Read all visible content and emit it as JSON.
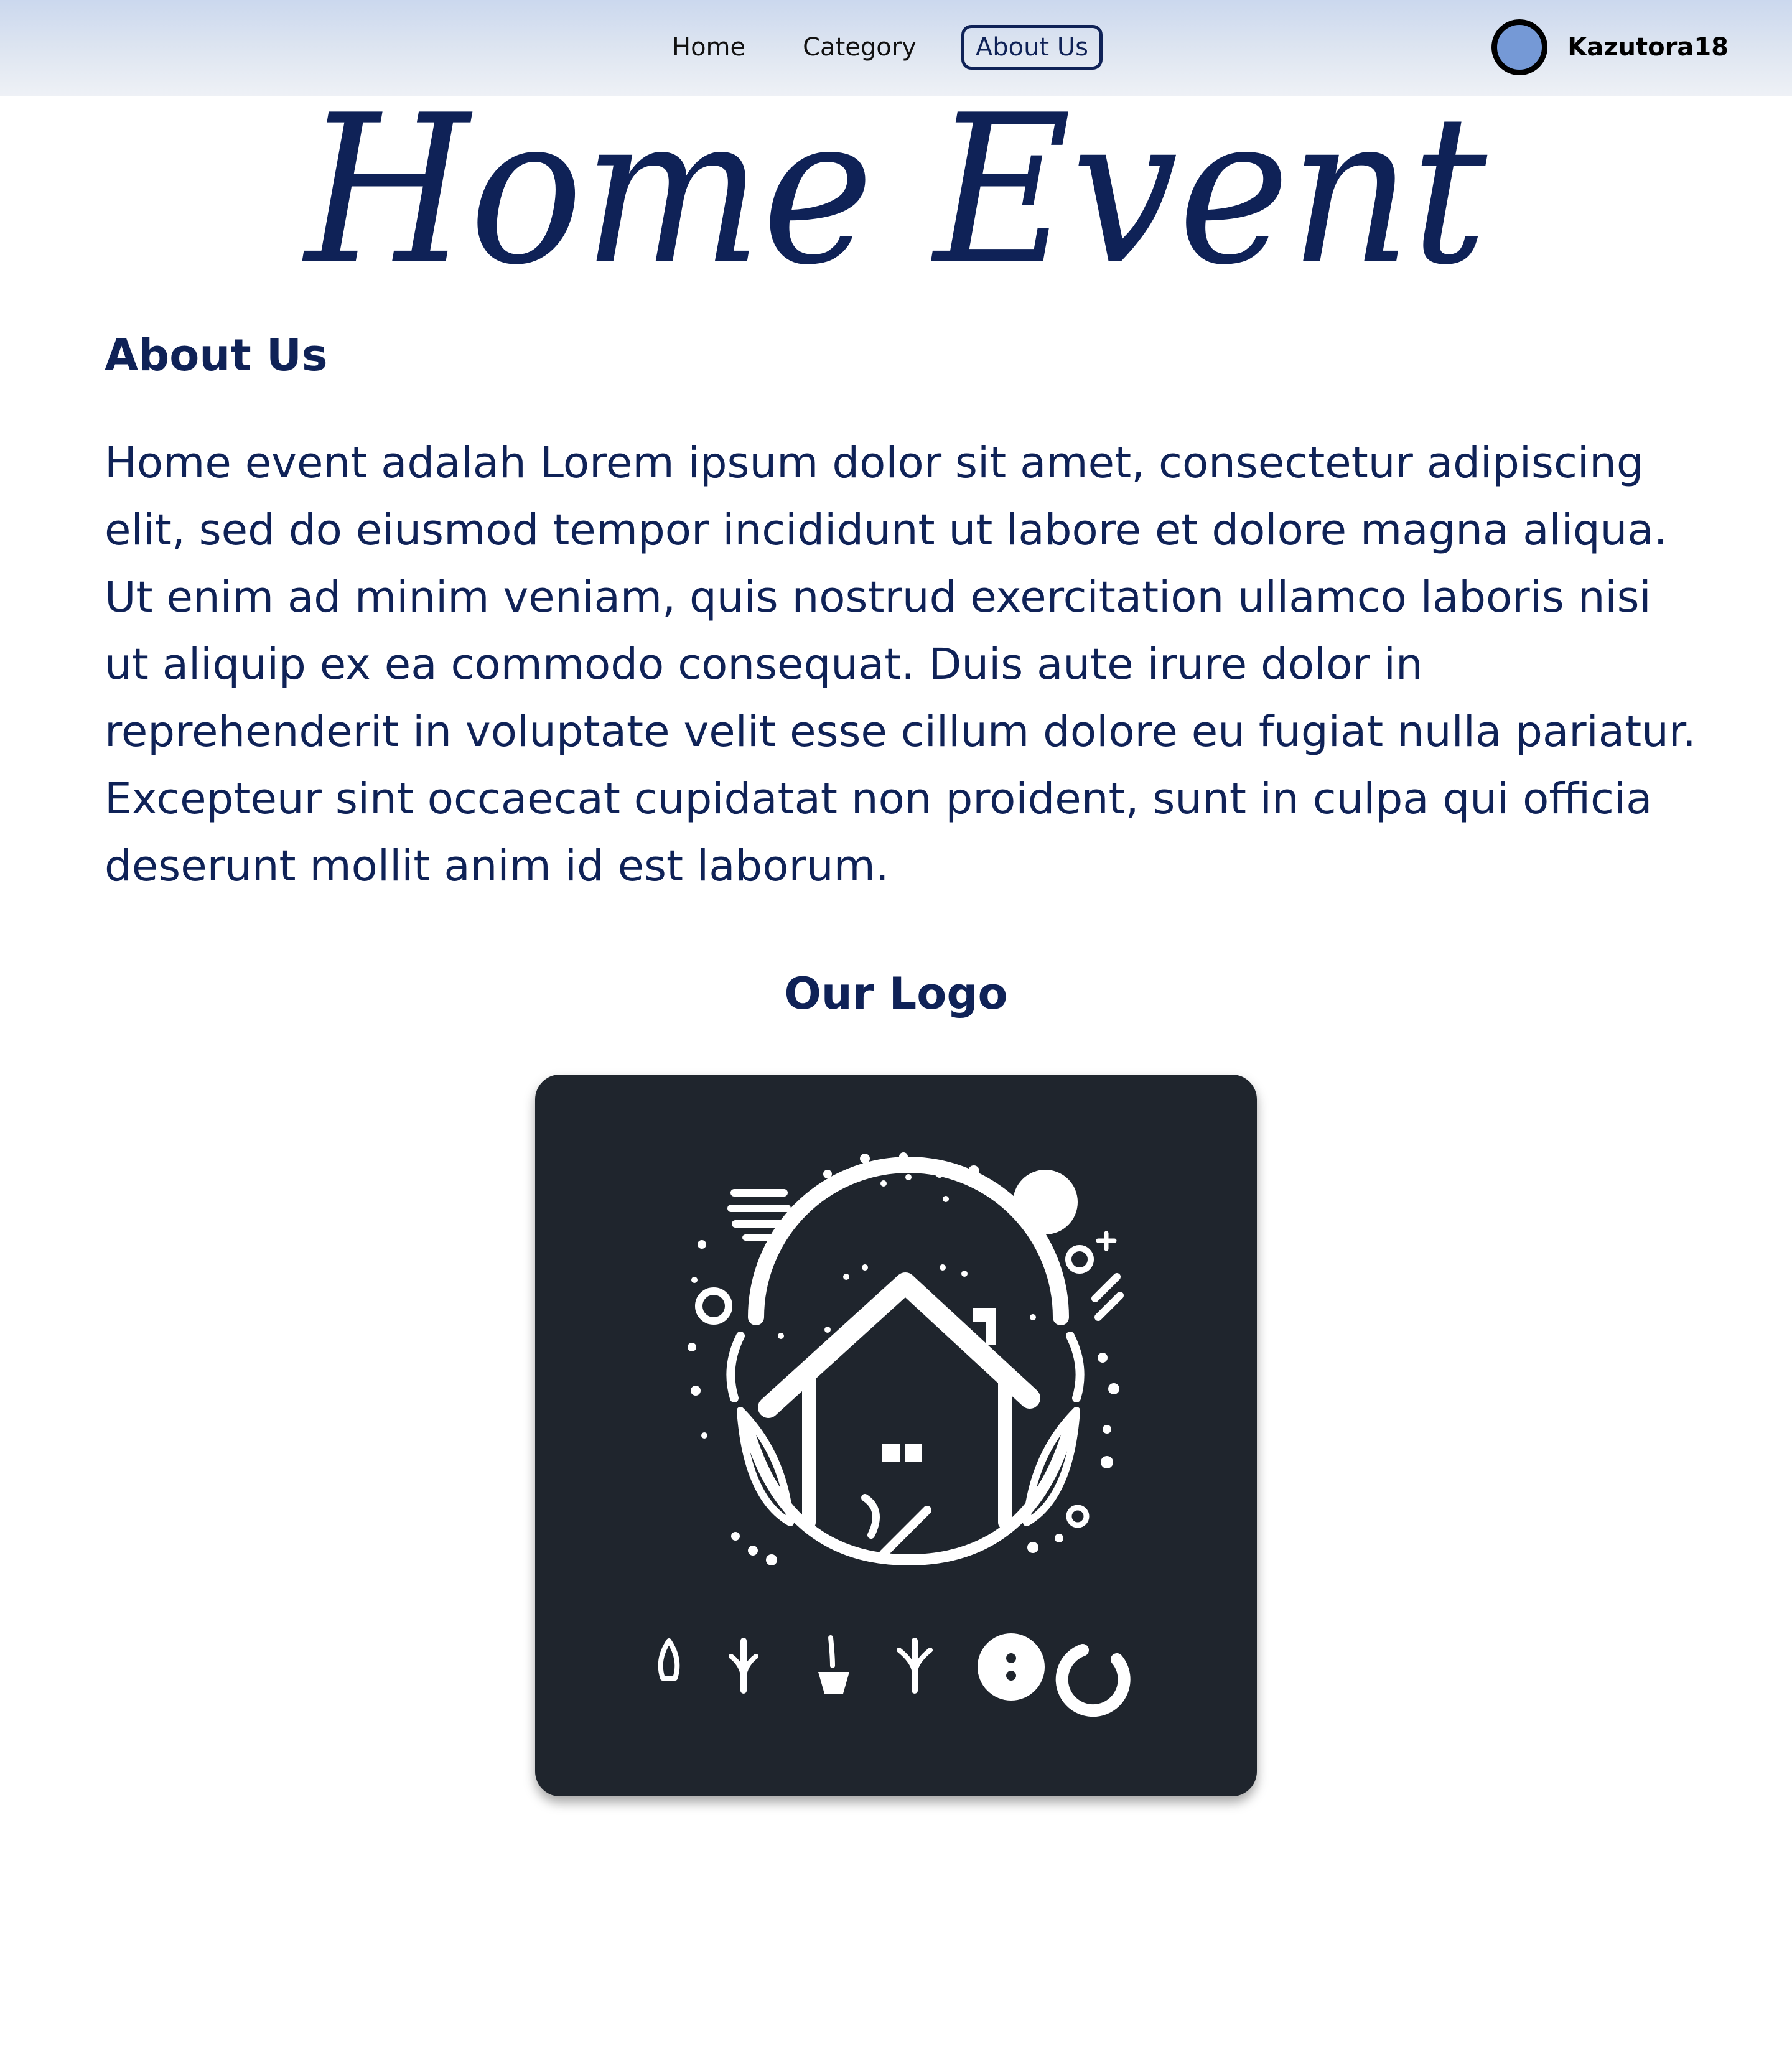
{
  "nav": {
    "links": [
      {
        "label": "Home"
      },
      {
        "label": "Category"
      },
      {
        "label": "About Us",
        "active": true
      }
    ]
  },
  "user": {
    "name": "Kazutora18",
    "avatar_color": "#7599d6"
  },
  "brand": {
    "title": "Home Event"
  },
  "about": {
    "heading": "About Us",
    "body": "Home event adalah Lorem ipsum dolor sit amet, consectetur adipiscing elit, sed do eiusmod tempor incididunt ut labore et dolore magna aliqua. Ut enim ad minim veniam, quis nostrud exercitation ullamco laboris nisi ut aliquip ex ea commodo consequat. Duis aute irure dolor in reprehenderit in voluptate velit esse cillum dolore eu fugiat nulla pariatur. Excepteur sint occaecat cupidatat non proident, sunt in culpa qui officia deserunt mollit anim id est laborum."
  },
  "logo": {
    "heading": "Our Logo",
    "icon": "house-emblem-logo"
  },
  "colors": {
    "primary": "#0f2257",
    "logo_background": "#1f252d",
    "navbar_top": "#cbd8ee"
  }
}
